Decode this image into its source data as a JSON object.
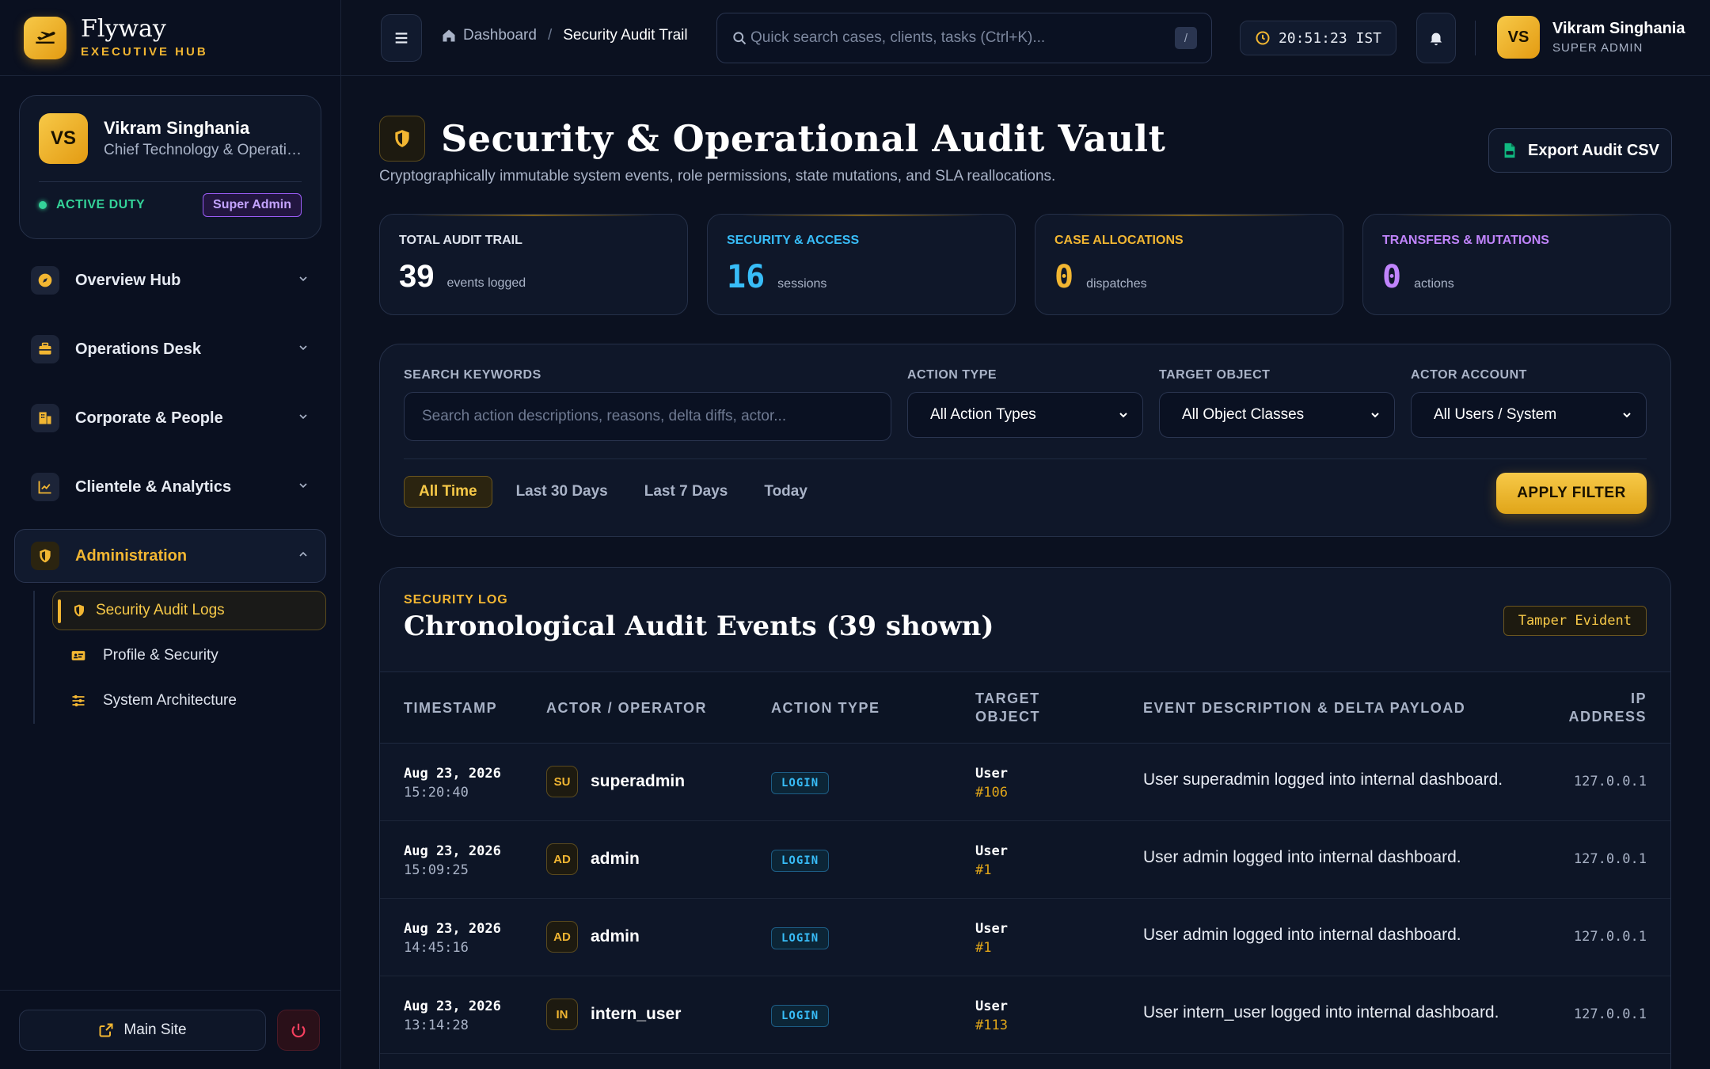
{
  "brand": {
    "name": "Flyway",
    "subtitle": "EXECUTIVE HUB"
  },
  "profile": {
    "initials": "VS",
    "name": "Vikram Singhania",
    "role": "Chief Technology & Operations Officer",
    "status": "ACTIVE DUTY",
    "badge": "Super Admin"
  },
  "sidebar": {
    "items": [
      {
        "label": "Overview Hub",
        "icon": "compass-icon"
      },
      {
        "label": "Operations Desk",
        "icon": "briefcase-icon"
      },
      {
        "label": "Corporate & People",
        "icon": "building-icon"
      },
      {
        "label": "Clientele & Analytics",
        "icon": "chart-icon"
      },
      {
        "label": "Administration",
        "icon": "shield-icon"
      }
    ],
    "subitems": [
      {
        "label": "Security Audit Logs",
        "icon": "shield-icon"
      },
      {
        "label": "Profile & Security",
        "icon": "id-card-icon"
      },
      {
        "label": "System Architecture",
        "icon": "sliders-icon"
      }
    ],
    "footer": {
      "main_site": "Main Site"
    }
  },
  "topbar": {
    "breadcrumb_home": "Dashboard",
    "breadcrumb_sep": "/",
    "breadcrumb_current": "Security Audit Trail",
    "search_placeholder": "Quick search cases, clients, tasks (Ctrl+K)...",
    "search_kbd": "/",
    "clock": "20:51:23 IST",
    "user_initials": "VS",
    "user_name": "Vikram Singhania",
    "user_role": "SUPER ADMIN"
  },
  "page": {
    "title": "Security & Operational Audit Vault",
    "subtitle": "Cryptographically immutable system events, role permissions, state mutations, and SLA reallocations.",
    "export_label": "Export Audit CSV"
  },
  "stats": [
    {
      "label": "TOTAL AUDIT TRAIL",
      "value": "39",
      "unit": "events logged",
      "color": "#e6eaf2",
      "label_color": "#dfe4ee"
    },
    {
      "label": "SECURITY & ACCESS",
      "value": "16",
      "unit": "sessions",
      "color": "#38bdf8",
      "label_color": "#38bdf8"
    },
    {
      "label": "CASE ALLOCATIONS",
      "value": "0",
      "unit": "dispatches",
      "color": "#f2b632",
      "label_color": "#f2b632"
    },
    {
      "label": "TRANSFERS & MUTATIONS",
      "value": "0",
      "unit": "actions",
      "color": "#c084fc",
      "label_color": "#c084fc"
    }
  ],
  "filters": {
    "keywords_label": "SEARCH KEYWORDS",
    "keywords_placeholder": "Search action descriptions, reasons, delta diffs, actor...",
    "action_label": "ACTION TYPE",
    "action_value": "All Action Types",
    "target_label": "TARGET OBJECT",
    "target_value": "All Object Classes",
    "actor_label": "ACTOR ACCOUNT",
    "actor_value": "All Users / System",
    "ranges": [
      "All Time",
      "Last 30 Days",
      "Last 7 Days",
      "Today"
    ],
    "apply_label": "APPLY FILTER"
  },
  "log": {
    "kicker": "SECURITY LOG",
    "title": "Chronological Audit Events (39 shown)",
    "tamper": "Tamper Evident",
    "columns": {
      "timestamp": "TIMESTAMP",
      "actor": "ACTOR / OPERATOR",
      "action": "ACTION TYPE",
      "target_1": "TARGET",
      "target_2": "OBJECT",
      "desc": "EVENT DESCRIPTION & DELTA PAYLOAD",
      "ip_1": "IP",
      "ip_2": "ADDRESS"
    },
    "rows": [
      {
        "date": "Aug 23, 2026",
        "time": "15:20:40",
        "initials": "SU",
        "actor": "superadmin",
        "action": "LOGIN",
        "object": "User",
        "object_id": "#106",
        "desc": "User superadmin logged into internal dashboard.",
        "ip": "127.0.0.1"
      },
      {
        "date": "Aug 23, 2026",
        "time": "15:09:25",
        "initials": "AD",
        "actor": "admin",
        "action": "LOGIN",
        "object": "User",
        "object_id": "#1",
        "desc": "User admin logged into internal dashboard.",
        "ip": "127.0.0.1"
      },
      {
        "date": "Aug 23, 2026",
        "time": "14:45:16",
        "initials": "AD",
        "actor": "admin",
        "action": "LOGIN",
        "object": "User",
        "object_id": "#1",
        "desc": "User admin logged into internal dashboard.",
        "ip": "127.0.0.1"
      },
      {
        "date": "Aug 23, 2026",
        "time": "13:14:28",
        "initials": "IN",
        "actor": "intern_user",
        "action": "LOGIN",
        "object": "User",
        "object_id": "#113",
        "desc": "User intern_user logged into internal dashboard.",
        "ip": "127.0.0.1"
      }
    ]
  }
}
